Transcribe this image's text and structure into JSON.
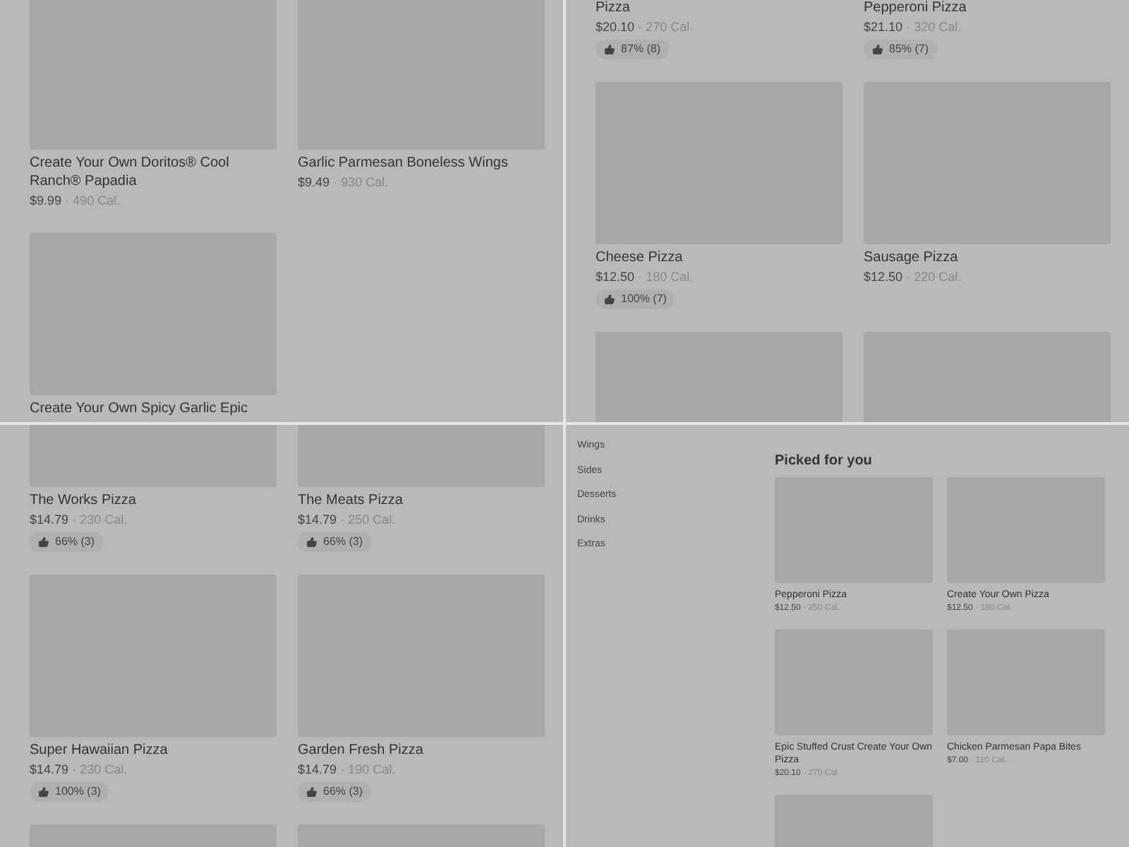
{
  "separator": "·",
  "panels": [
    {
      "kind": "menu_grid",
      "items": [
        {
          "kind": "card",
          "name": "Create Your Own Doritos® Cool Ranch® Papadia",
          "price": "$9.99",
          "calories": "490 Cal."
        },
        {
          "kind": "card",
          "name": "Garlic Parmesan Boneless Wings",
          "price": "$9.49",
          "calories": "930 Cal."
        },
        {
          "kind": "card",
          "name": "Create Your Own Spicy Garlic Epic"
        }
      ]
    },
    {
      "kind": "menu_grid",
      "items": [
        {
          "kind": "cut",
          "name": "Pizza",
          "price": "$20.10",
          "calories": "270 Cal.",
          "rating": "87% (8)"
        },
        {
          "kind": "cut",
          "name": "Pepperoni Pizza",
          "price": "$21.10",
          "calories": "320 Cal.",
          "rating": "85% (7)"
        },
        {
          "kind": "card",
          "name": "Cheese Pizza",
          "price": "$12.50",
          "calories": "180 Cal.",
          "rating": "100% (7)"
        },
        {
          "kind": "card",
          "name": "Sausage Pizza",
          "price": "$12.50",
          "calories": "220 Cal."
        },
        {
          "kind": "image"
        },
        {
          "kind": "image"
        }
      ]
    },
    {
      "kind": "menu_grid",
      "items": [
        {
          "kind": "card",
          "name": "The Works Pizza",
          "price": "$14.79",
          "calories": "230 Cal.",
          "rating": "66% (3)"
        },
        {
          "kind": "card",
          "name": "The Meats Pizza",
          "price": "$14.79",
          "calories": "250 Cal.",
          "rating": "66% (3)"
        },
        {
          "kind": "card",
          "name": "Super Hawaiian Pizza",
          "price": "$14.79",
          "calories": "230 Cal.",
          "rating": "100% (3)"
        },
        {
          "kind": "card",
          "name": "Garden Fresh Pizza",
          "price": "$14.79",
          "calories": "190 Cal.",
          "rating": "66% (3)"
        },
        {
          "kind": "image"
        },
        {
          "kind": "image"
        }
      ]
    },
    {
      "kind": "category_page",
      "categories": [
        "Wings",
        "Sides",
        "Desserts",
        "Drinks",
        "Extras"
      ],
      "section_title": "Picked for you",
      "items": [
        {
          "kind": "card",
          "name": "Pepperoni Pizza",
          "price": "$12.50",
          "calories": "250 Cal."
        },
        {
          "kind": "card",
          "name": "Create Your Own Pizza",
          "price": "$12.50",
          "calories": "180 Cal."
        },
        {
          "kind": "card",
          "name": "Epic Stuffed Crust Create Your Own Pizza",
          "price": "$20.10",
          "calories": "270 Cal."
        },
        {
          "kind": "card",
          "name": "Chicken Parmesan Papa Bites",
          "price": "$7.00",
          "calories": "110 Cal."
        },
        {
          "kind": "image"
        }
      ]
    }
  ]
}
